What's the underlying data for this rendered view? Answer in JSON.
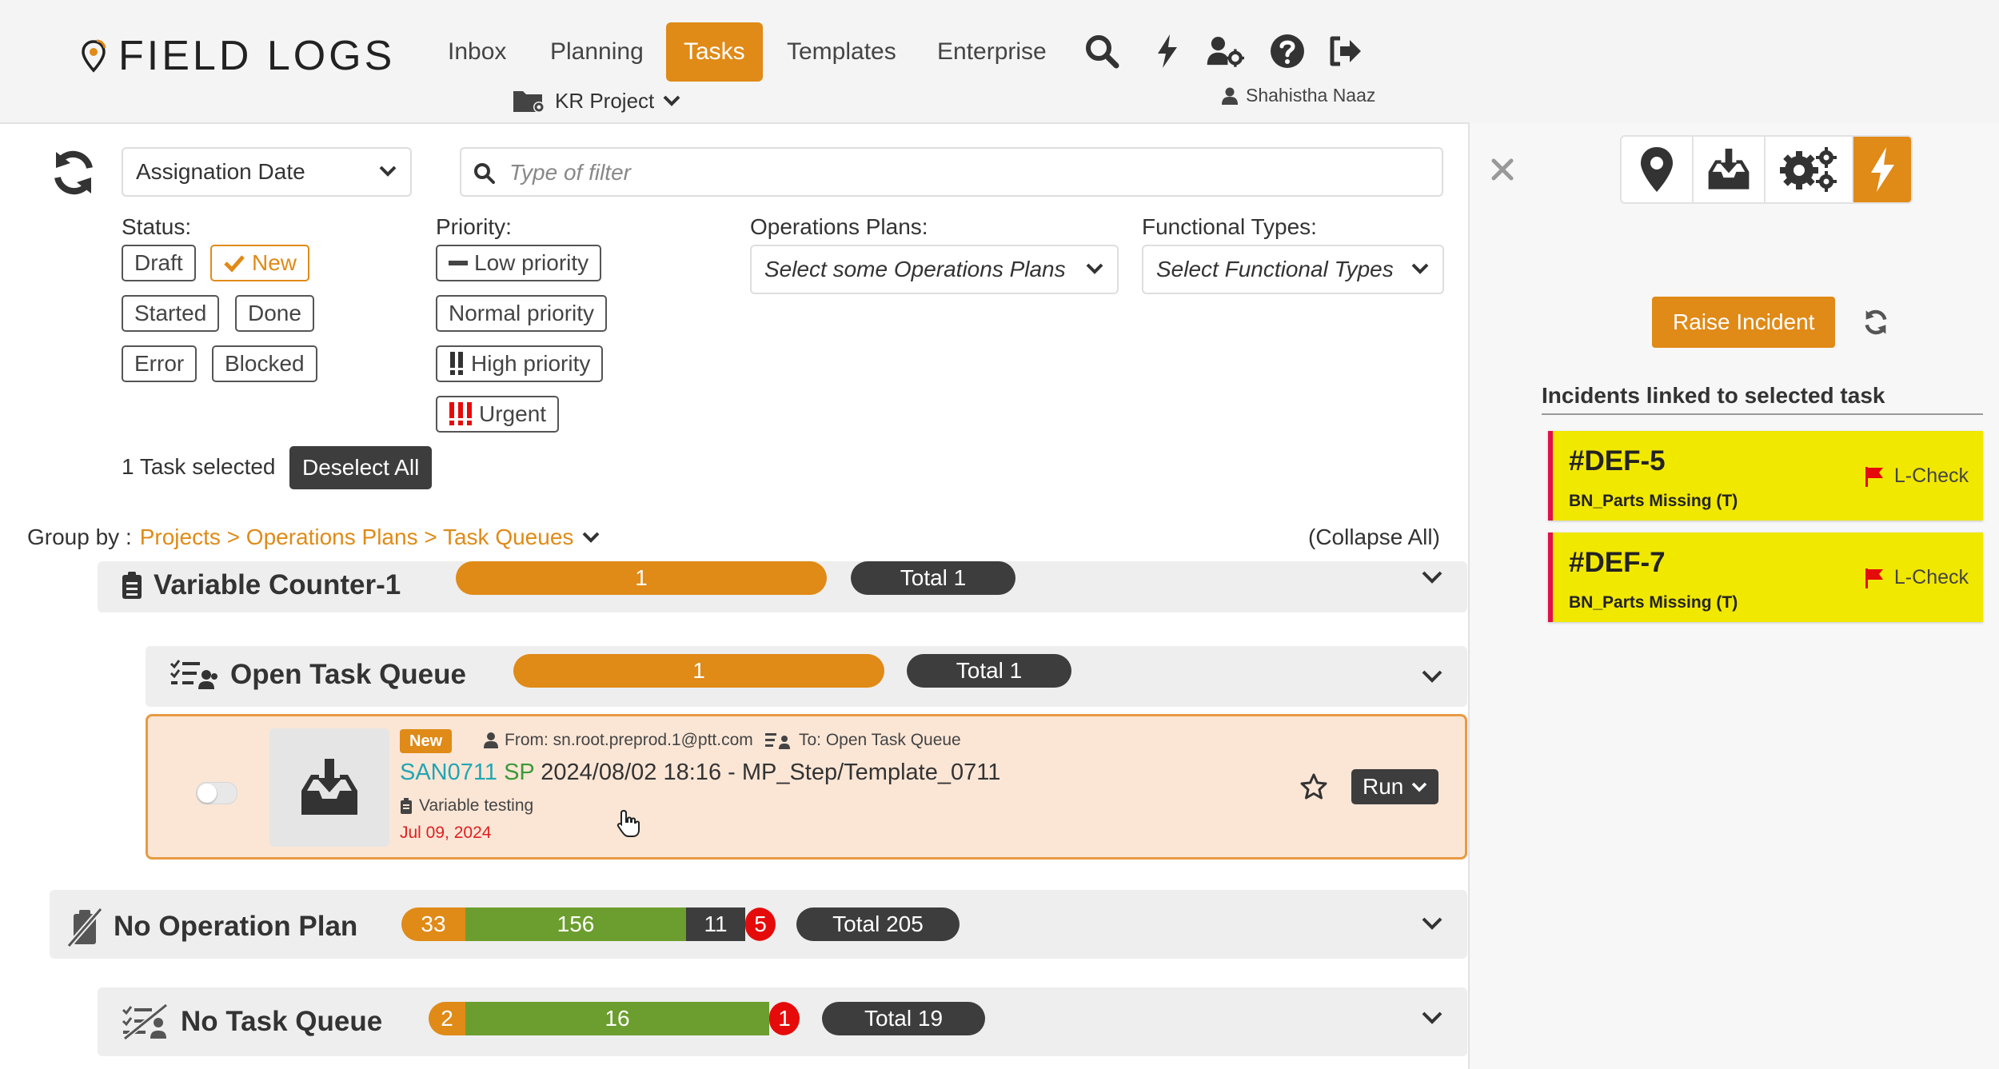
{
  "header": {
    "brand": "FIELD LOGS",
    "nav": [
      {
        "label": "Inbox"
      },
      {
        "label": "Planning"
      },
      {
        "label": "Tasks"
      },
      {
        "label": "Templates"
      },
      {
        "label": "Enterprise"
      }
    ],
    "active_nav": "Tasks",
    "project": "KR Project",
    "user": "Shahistha Naaz",
    "icons": [
      "search-icon",
      "bolt-icon",
      "user-settings-icon",
      "help-icon",
      "logout-icon"
    ]
  },
  "filters": {
    "sort_select": "Assignation Date",
    "search_placeholder": "Type of filter",
    "status_label": "Status:",
    "status": [
      "Draft",
      "New",
      "Started",
      "Done",
      "Error",
      "Blocked"
    ],
    "status_selected": "New",
    "priority_label": "Priority:",
    "priority": [
      "Low priority",
      "Normal priority",
      "High priority",
      "Urgent"
    ],
    "operations_plans_label": "Operations Plans:",
    "operations_plans_placeholder": "Select some Operations Plans",
    "functional_types_label": "Functional Types:",
    "functional_types_placeholder": "Select Functional Types"
  },
  "selection": {
    "text": "1 Task selected",
    "deselect_label": "Deselect All"
  },
  "groupby": {
    "label": "Group by :",
    "path": "Projects > Operations Plans > Task Queues",
    "collapse_all": "(Collapse All)"
  },
  "groups": {
    "variable_counter": {
      "title": "Variable Counter-1",
      "count": "1",
      "total": "Total 1"
    },
    "open_task_queue": {
      "title": "Open Task Queue",
      "count": "1",
      "total": "Total 1"
    },
    "no_operation_plan": {
      "title": "No Operation Plan",
      "segments": [
        "33",
        "156",
        "11",
        "5"
      ],
      "total": "Total 205"
    },
    "no_task_queue": {
      "title": "No Task Queue",
      "segments": [
        "2",
        "16",
        "1"
      ],
      "total": "Total 19"
    }
  },
  "task": {
    "badge": "New",
    "from": "From: sn.root.preprod.1@ptt.com",
    "to": "To: Open Task Queue",
    "code": "SAN0711",
    "sp": "SP",
    "title_rest": "2024/08/02 18:16 - MP_Step/Template_0711",
    "description": "Variable testing",
    "date": "Jul 09, 2024",
    "run_label": "Run"
  },
  "right_panel": {
    "tool_icons": [
      "map-marker-icon",
      "inbox-download-icon",
      "cogs-icon",
      "bolt-icon"
    ],
    "raise_incident_label": "Raise Incident",
    "incidents_heading": "Incidents linked to selected task",
    "incidents": [
      {
        "id": "#DEF-5",
        "name": "BN_Parts Missing (T)",
        "tag": "L-Check"
      },
      {
        "id": "#DEF-7",
        "name": "BN_Parts Missing (T)",
        "tag": "L-Check"
      }
    ]
  },
  "colors": {
    "accent": "#e08a17",
    "dark": "#3d3d3d",
    "done_green": "#6b9e2e",
    "error_red": "#e50b0b",
    "incident_yellow": "#f1e800"
  }
}
